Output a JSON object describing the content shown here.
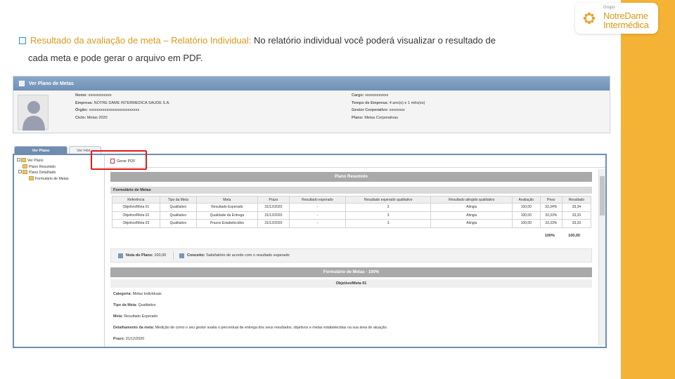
{
  "logo": {
    "grupo": "Grupo",
    "line1": "NotreDame",
    "line2": "Intermédica"
  },
  "slide": {
    "title": "Resultado da avaliação de meta – Relatório Individual:",
    "text1": " No relatório individual você poderá visualizar o resultado de",
    "text2": "cada meta e pode gerar o arquivo em PDF."
  },
  "window": {
    "title": "Ver Plano de Metas",
    "fields_left": [
      {
        "label": "Nome:",
        "value": "xxxxxxxxxxxx"
      },
      {
        "label": "Empresa:",
        "value": "NOTRE DAME INTERMEDICA SAUDE S.A."
      },
      {
        "label": "Órgão:",
        "value": "xxxxxxxxxxxxxxxxxxxxxxxxxx"
      },
      {
        "label": "Ciclo:",
        "value": "Metas 2020"
      }
    ],
    "fields_right": [
      {
        "label": "Cargo:",
        "value": "xxxxxxxxxxxx"
      },
      {
        "label": "Tempo de Empresa:",
        "value": "4 ano(s) e 1 mês(es)"
      },
      {
        "label": "Gestor Corporativo:",
        "value": "xxxxxxxx"
      },
      {
        "label": "Plano:",
        "value": "Metas Corporativas"
      }
    ]
  },
  "tabs": [
    "Ver Plano",
    "Ver Hist..."
  ],
  "tree": [
    "Ver Plano",
    "Plano Resumido",
    "Plano Detalhado",
    "Formulário de Metas"
  ],
  "toolbar": {
    "pdf_label": "Gerar PDF"
  },
  "resumo": {
    "title": "Plano Resumido",
    "section": "Formulário de Metas",
    "headers": [
      "Referência",
      "Tipo da Meta",
      "Meta",
      "Prazo",
      "Resultado esperado",
      "Resultado esperado qualitativo",
      "Resultado atingido qualitativo",
      "Avaliação",
      "Peso",
      "Resultado"
    ],
    "rows": [
      [
        "Objetivo/Meta 01",
        "Qualitativo",
        "Resultado Esperado",
        "31/12/2020",
        "-",
        "3",
        "Atingiu",
        "100,00",
        "33,34%",
        "33,34"
      ],
      [
        "Objetivo/Meta 02",
        "Qualitativo",
        "Qualidade da Entrega",
        "31/12/2020",
        "-",
        "3",
        "Atingiu",
        "100,00",
        "33,33%",
        "33,33"
      ],
      [
        "Objetivo/Meta 03",
        "Qualitativo",
        "Prazos Estabelecidos",
        "31/12/2020",
        "-",
        "3",
        "Atingiu",
        "100,00",
        "33,33%",
        "33,33"
      ]
    ],
    "total_pct": "100%",
    "total_res": "100,00",
    "nota_label": "Nota do Plano:",
    "nota_value": "100,00",
    "conceito_label": "Conceito:",
    "conceito_value": "Satisfatório de acordo com o resultado esperado"
  },
  "formulario": {
    "title": "Formulário de Metas - 100%",
    "sub": "Objetivo/Meta 01",
    "items": [
      {
        "label": "Categoria:",
        "value": "Metas Individuais"
      },
      {
        "label": "Tipo da Meta:",
        "value": "Qualitativo"
      },
      {
        "label": "Meta:",
        "value": "Resultado Esperado"
      },
      {
        "label": "Detalhamento da meta:",
        "value": "Medição de como o seu gestor avalia o percentual de entrega dos seus resultados, objetivos e metas estabelecidas na sua área de atuação."
      },
      {
        "label": "Prazo:",
        "value": "31/12/2020"
      }
    ]
  },
  "colors": {
    "accent_band": "#f5b335",
    "header_blue": "#6e8db0",
    "highlight_red": "#e21a1a",
    "title_orange": "#d89a1c"
  }
}
